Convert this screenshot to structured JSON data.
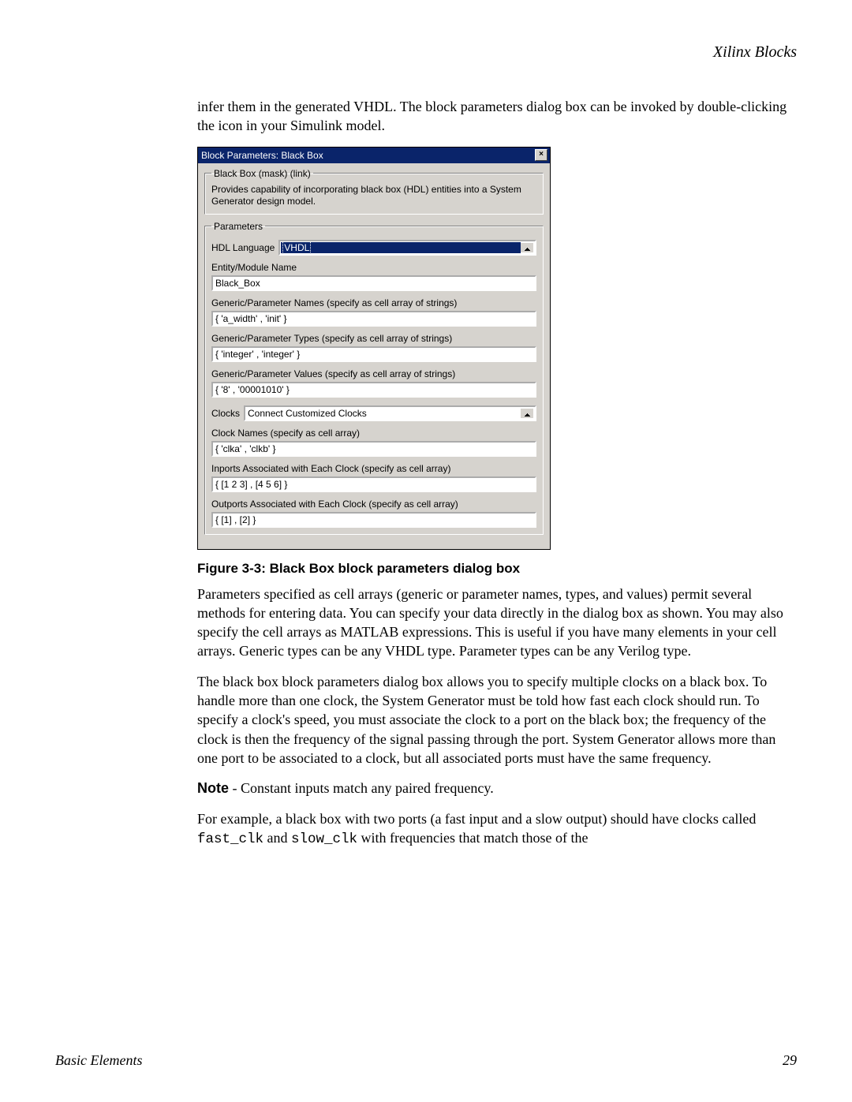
{
  "running_head": "Xilinx Blocks",
  "intro": "infer them in the generated VHDL. The block parameters dialog box can be invoked by double-clicking the icon in your Simulink model.",
  "dialog": {
    "title": "Block Parameters: Black Box",
    "close_glyph": "×",
    "mask_legend": "Black Box (mask) (link)",
    "mask_desc": "Provides capability of incorporating black box (HDL) entities into a System Generator design model.",
    "params_legend": "Parameters",
    "hdl_label": "HDL Language",
    "hdl_value": "VHDL",
    "entity_label": "Entity/Module Name",
    "entity_value": "Black_Box",
    "gp_names_label": "Generic/Parameter Names  (specify as cell array of strings)",
    "gp_names_value": "{ 'a_width' , 'init' }",
    "gp_types_label": "Generic/Parameter Types  (specify as cell array of strings)",
    "gp_types_value": "{ 'integer' , 'integer' }",
    "gp_values_label": "Generic/Parameter Values  (specify as cell array of strings)",
    "gp_values_value": "{ '8' , '00001010' }",
    "clocks_label": "Clocks",
    "clocks_value": "Connect Customized Clocks",
    "clock_names_label": "Clock Names  (specify as cell array)",
    "clock_names_value": "{ 'clka' , 'clkb' }",
    "inports_label": "Inports Associated with Each Clock  (specify as cell array)",
    "inports_value": "{ [1 2 3] , [4 5 6] }",
    "outports_label": "Outports Associated with Each Clock  (specify as cell array)",
    "outports_value": "{ [1] , [2] }"
  },
  "figure_caption": "Figure 3-3:   Black Box block parameters dialog box",
  "para1": "Parameters specified as cell arrays (generic or parameter names, types, and values) permit several methods for entering data. You can specify your data directly in the dialog box as shown. You may also specify the cell arrays as MATLAB expressions. This is useful if you have many elements in your cell arrays. Generic types can be any VHDL type. Parameter types can be any Verilog type.",
  "para2": "The black box block parameters dialog box allows you to specify multiple clocks on a black box. To handle more than one clock, the System Generator must be told how fast each clock should run. To specify a clock's speed, you must associate the clock to a port on the black box; the frequency of the clock is then the frequency of the signal passing through the port. System Generator allows more than one port to be associated to a clock, but all associated ports must have the same frequency.",
  "note_label": "Note",
  "note_text": " - Constant inputs match any paired frequency.",
  "para3_pre": "For example, a black box with two ports (a fast input and a slow output) should have clocks called ",
  "code1": "fast_clk",
  "para3_mid": " and  ",
  "code2": "slow_clk",
  "para3_post": " with frequencies that match those of the",
  "footer_left": "Basic Elements",
  "footer_right": "29"
}
